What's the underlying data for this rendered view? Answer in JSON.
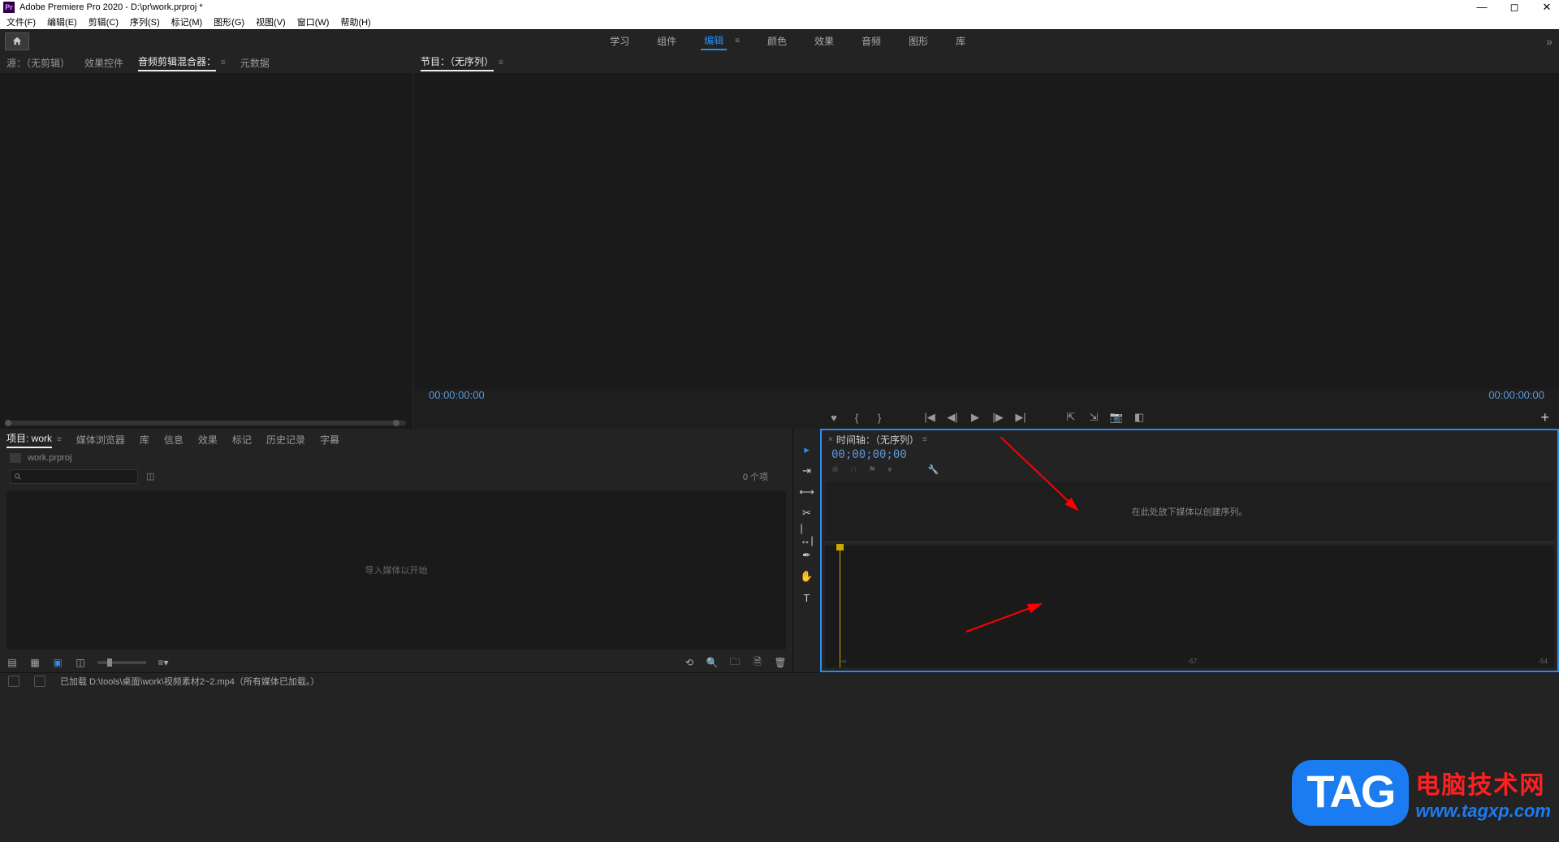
{
  "titlebar": {
    "app_icon_text": "Pr",
    "title": "Adobe Premiere Pro 2020 - D:\\pr\\work.prproj *"
  },
  "menubar": {
    "items": [
      "文件(F)",
      "编辑(E)",
      "剪辑(C)",
      "序列(S)",
      "标记(M)",
      "图形(G)",
      "视图(V)",
      "窗口(W)",
      "帮助(H)"
    ]
  },
  "workspaces": {
    "items": [
      "学习",
      "组件",
      "编辑",
      "颜色",
      "效果",
      "音频",
      "图形",
      "库"
    ],
    "active_index": 2,
    "overflow": "»"
  },
  "source_panel": {
    "tabs": [
      "源：（无剪辑）",
      "效果控件",
      "音频剪辑混合器：",
      "元数据"
    ],
    "active_index": 2
  },
  "program_panel": {
    "title": "节目：（无序列）",
    "timecode_left": "00:00:00:00",
    "timecode_right": "00:00:00:00",
    "plus_label": "+"
  },
  "project_panel": {
    "tabs": [
      "项目: work",
      "媒体浏览器",
      "库",
      "信息",
      "效果",
      "标记",
      "历史记录",
      "字幕"
    ],
    "active_index": 0,
    "project_name": "work.prproj",
    "search_placeholder": "",
    "item_count": "0 个项",
    "empty_msg": "导入媒体以开始"
  },
  "timeline_panel": {
    "title": "时间轴：（无序列）",
    "timecode": "00;00;00;00",
    "drop_msg": "在此处放下媒体以创建序列。",
    "scale": [
      "-∞",
      "-57",
      "-54"
    ]
  },
  "statusbar": {
    "message": "已加载 D:\\tools\\桌面\\work\\视频素材2~2.mp4（所有媒体已加载。）"
  },
  "watermark": {
    "tag": "TAG",
    "cn": "电脑技术网",
    "url": "www.tagxp.com"
  }
}
